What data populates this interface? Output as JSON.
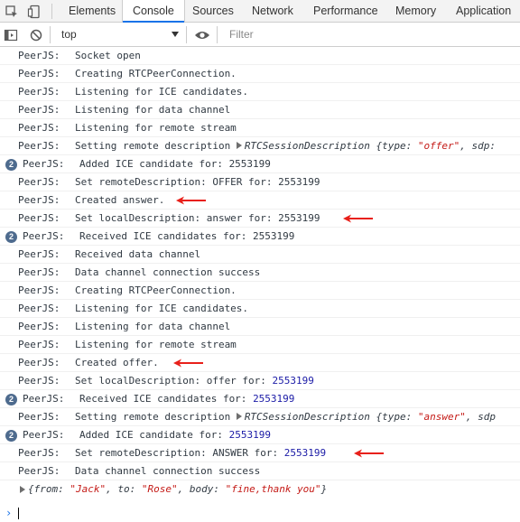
{
  "tabs": [
    "Elements",
    "Console",
    "Sources",
    "Network",
    "Performance",
    "Memory",
    "Application"
  ],
  "active_tab": "Console",
  "toolbar": {
    "context": "top",
    "filter_placeholder": "Filter"
  },
  "icons": {
    "inspect": "inspect-element-icon",
    "device": "device-toggle-icon",
    "sidebar": "sidebar-toggle-icon",
    "clear": "clear-console-icon",
    "eye": "live-expression-icon"
  },
  "colors": {
    "accent": "#1a73e8",
    "annotation_arrow": "#e8201a",
    "badge": "#4e6b8e",
    "number": "#1a1aa6",
    "string": "#c41a16"
  },
  "messages": [
    {
      "prefix": "PeerJS:",
      "text": "Socket open"
    },
    {
      "prefix": "PeerJS:",
      "text": "Creating RTCPeerConnection."
    },
    {
      "prefix": "PeerJS:",
      "text": "Listening for ICE candidates."
    },
    {
      "prefix": "PeerJS:",
      "text": "Listening for data channel"
    },
    {
      "prefix": "PeerJS:",
      "text": "Listening for remote stream"
    },
    {
      "prefix": "PeerJS:",
      "text": "Setting remote description",
      "obj_name": "RTCSessionDescription",
      "obj_open": "{type: ",
      "obj_str": "\"offer\"",
      "obj_tail": ", sdp:"
    },
    {
      "prefix": "PeerJS:",
      "text": "Added ICE candidate for: 2553199",
      "badge": "2"
    },
    {
      "prefix": "PeerJS:",
      "text": "Set remoteDescription: OFFER for: 2553199"
    },
    {
      "prefix": "PeerJS:",
      "text": "Created answer."
    },
    {
      "prefix": "PeerJS:",
      "text": "Set localDescription: answer for: 2553199"
    },
    {
      "prefix": "PeerJS:",
      "text": "Received ICE candidates for: 2553199",
      "badge": "2"
    },
    {
      "prefix": "PeerJS:",
      "text": "Received data channel"
    },
    {
      "prefix": "PeerJS:",
      "text": "Data channel connection success"
    },
    {
      "prefix": "PeerJS:",
      "text": "Creating RTCPeerConnection."
    },
    {
      "prefix": "PeerJS:",
      "text": "Listening for ICE candidates."
    },
    {
      "prefix": "PeerJS:",
      "text": "Listening for data channel"
    },
    {
      "prefix": "PeerJS:",
      "text": "Listening for remote stream"
    },
    {
      "prefix": "PeerJS:",
      "text": "Created offer."
    },
    {
      "prefix": "PeerJS:",
      "text": "Set localDescription: offer for:",
      "num": "2553199"
    },
    {
      "prefix": "PeerJS:",
      "text": "Received ICE candidates for:",
      "num": "2553199",
      "badge": "2"
    },
    {
      "prefix": "PeerJS:",
      "text": "Setting remote description",
      "obj_name": "RTCSessionDescription",
      "obj_open": "{type: ",
      "obj_str": "\"answer\"",
      "obj_tail": ", sdp"
    },
    {
      "prefix": "PeerJS:",
      "text": "Added ICE candidate for:",
      "num": "2553199",
      "badge": "2"
    },
    {
      "prefix": "PeerJS:",
      "text": "Set remoteDescription: ANSWER for:",
      "num": "2553199"
    },
    {
      "prefix": "PeerJS:",
      "text": "Data channel connection success"
    }
  ],
  "logged_object": {
    "open": "{from: ",
    "from": "\"Jack\"",
    "to_key": ", to: ",
    "to": "\"Rose\"",
    "body_key": ", body: ",
    "body": "\"fine,thank you\"",
    "close": "}"
  },
  "annotation_arrow_rows": [
    8,
    9,
    17,
    22
  ]
}
